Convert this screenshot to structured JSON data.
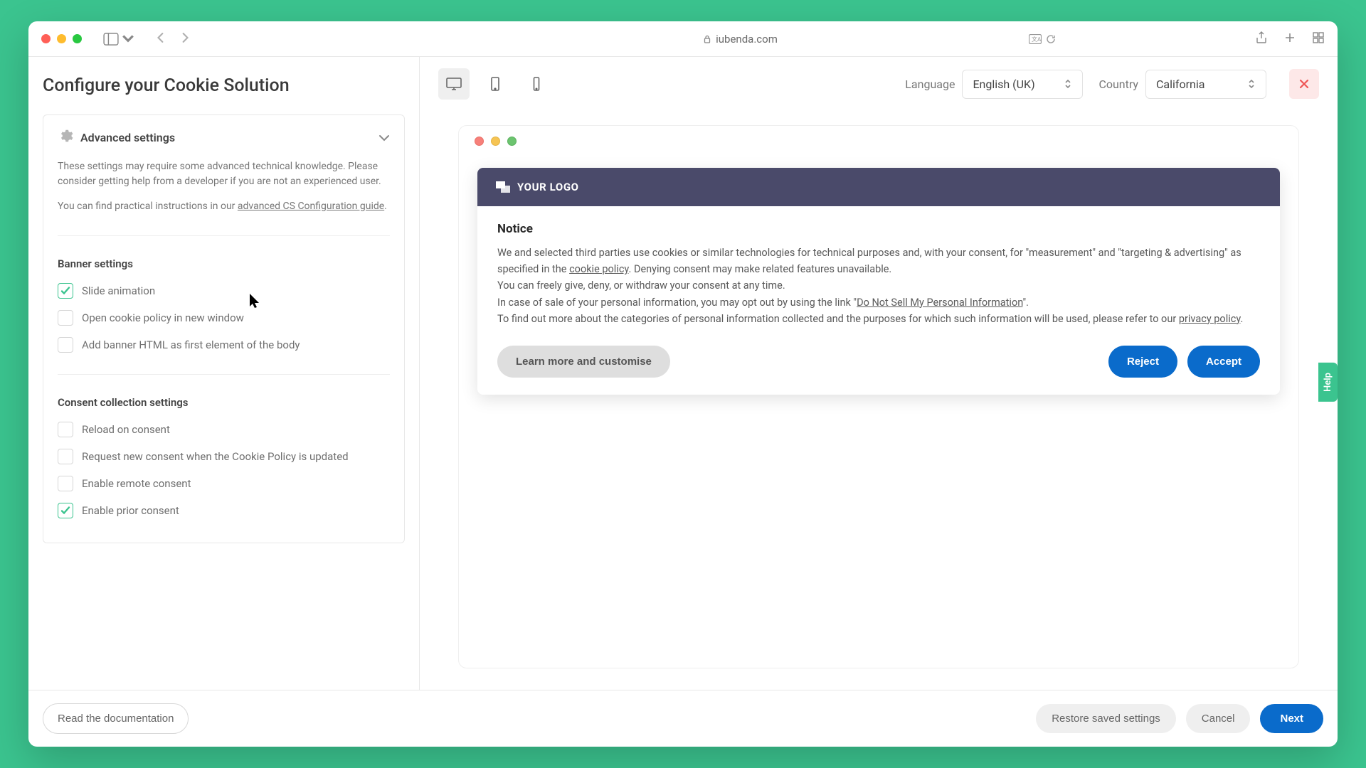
{
  "browser": {
    "url_host": "iubenda.com"
  },
  "left": {
    "title": "Configure your Cookie Solution",
    "accordion_label": "Advanced settings",
    "note": "These settings may require some advanced technical knowledge. Please consider getting help from a developer if you are not an experienced user.",
    "link_prefix": "You can find practical instructions in our ",
    "link_text": "advanced CS Configuration guide",
    "banner_heading": "Banner settings",
    "banner_opts": [
      {
        "label": "Slide animation",
        "checked": true
      },
      {
        "label": "Open cookie policy in new window",
        "checked": false
      },
      {
        "label": "Add banner HTML as first element of the body",
        "checked": false
      }
    ],
    "consent_heading": "Consent collection settings",
    "consent_opts": [
      {
        "label": "Reload on consent",
        "checked": false
      },
      {
        "label": "Request new consent when the Cookie Policy is updated",
        "checked": false
      },
      {
        "label": "Enable remote consent",
        "checked": false
      },
      {
        "label": "Enable prior consent",
        "checked": true
      }
    ]
  },
  "right": {
    "language_label": "Language",
    "language_value": "English (UK)",
    "country_label": "Country",
    "country_value": "California"
  },
  "notice": {
    "brand": "YOUR LOGO",
    "title": "Notice",
    "p1a": "We and selected third parties use cookies or similar technologies for technical purposes and, with your consent, for \"measurement\" and \"targeting & advertising\" as specified in the ",
    "cookie_policy": "cookie policy",
    "p1b": ". Denying consent may make related features unavailable.",
    "p2": "You can freely give, deny, or withdraw your consent at any time.",
    "p3a": "In case of sale of your personal information, you may opt out by using the link \"",
    "dns": "Do Not Sell My Personal Information",
    "p3b": "\".",
    "p4a": "To find out more about the categories of personal information collected and the purposes for which such information will be used, please refer to our ",
    "privacy_policy": "privacy policy",
    "p4b": ".",
    "learn": "Learn more and customise",
    "reject": "Reject",
    "accept": "Accept"
  },
  "footer": {
    "docs": "Read the documentation",
    "restore": "Restore saved settings",
    "cancel": "Cancel",
    "next": "Next"
  },
  "help_label": "Help"
}
